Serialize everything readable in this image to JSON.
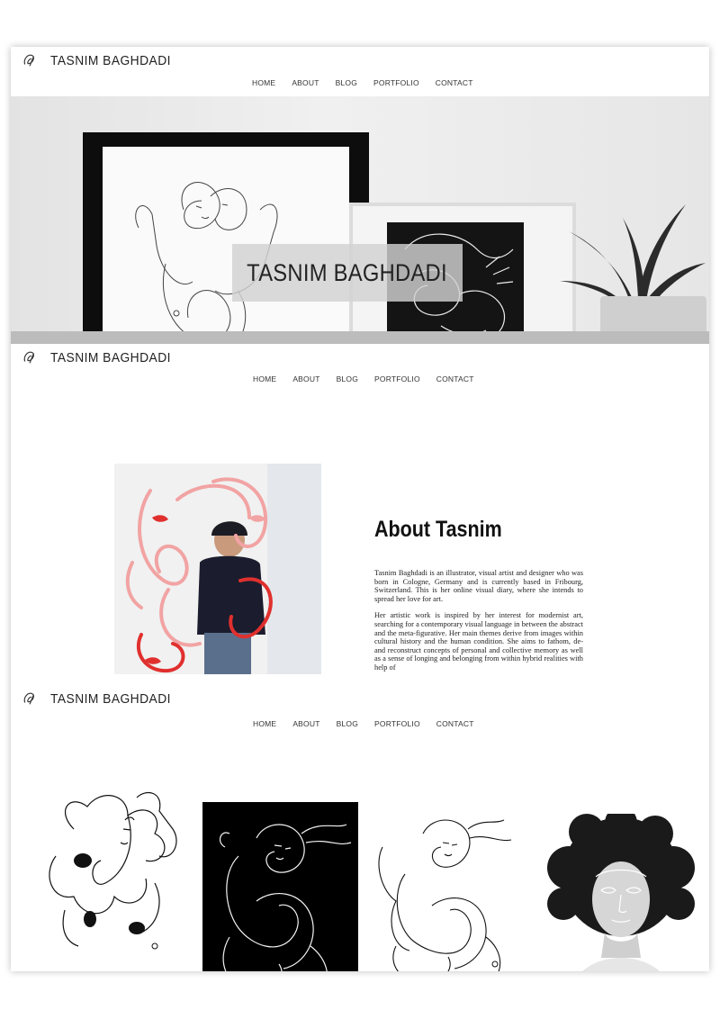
{
  "brand": {
    "name": "TASNIM BAGHDADI",
    "logo_icon": "signature-logo-icon"
  },
  "nav": {
    "items": [
      {
        "label": "HOME"
      },
      {
        "label": "ABOUT"
      },
      {
        "label": "BLOG"
      },
      {
        "label": "PORTFOLIO"
      },
      {
        "label": "CONTACT"
      }
    ]
  },
  "hero": {
    "title": "TASNIM BAGHDADI"
  },
  "about": {
    "title": "About Tasnim",
    "paragraphs": [
      "Tasnim Baghdadi is an illustrator, visual artist and designer who was born in Cologne, Germany and is currently based in Fribourg, Switzerland. This is her online visual diary, where she intends to spread her love for art.",
      "Her artistic work is inspired by her interest for modernist art, searching for a contemporary visual language in between the abstract and the meta-figurative. Her main themes derive from images within cultural history and the human condition. She aims to fathom, de- and reconstruct concepts of personal and collective memory as well as a sense of longing and belonging from within hybrid realities with help of"
    ]
  },
  "colors": {
    "accent_red": "#e0302e",
    "accent_pink": "#f2a3a3",
    "text": "#222222"
  }
}
